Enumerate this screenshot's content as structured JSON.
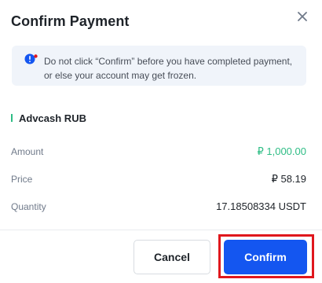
{
  "dialog": {
    "title": "Confirm Payment",
    "close_icon": "close-icon"
  },
  "notice": {
    "icon": "alert-circle-icon",
    "text": "Do not click “Confirm” before you have completed payment, or else your account may get frozen."
  },
  "payment_method": {
    "label": "Advcash RUB"
  },
  "details": {
    "amount": {
      "label": "Amount",
      "value": "₽ 1,000.00"
    },
    "price": {
      "label": "Price",
      "value": "₽ 58.19"
    },
    "quantity": {
      "label": "Quantity",
      "value": "17.18508334 USDT"
    }
  },
  "buttons": {
    "cancel_label": "Cancel",
    "confirm_label": "Confirm"
  },
  "colors": {
    "accent_blue": "#1456f0",
    "positive_green": "#2ebd85",
    "alert_red": "#e0171d",
    "notice_bg": "#f0f4fa"
  }
}
